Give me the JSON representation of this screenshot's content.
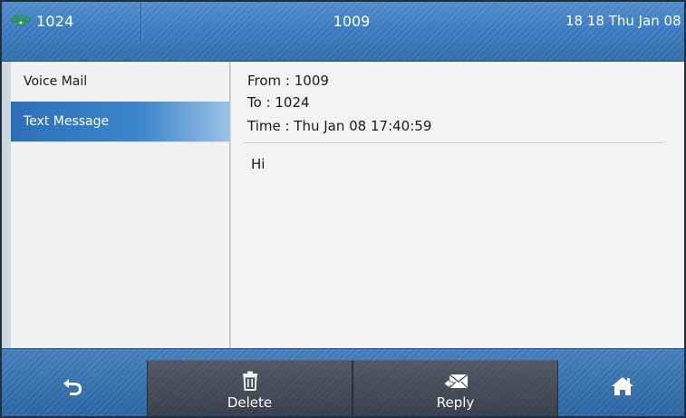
{
  "title_bar": {
    "account": "1024",
    "center": "1009",
    "datetime": "18 18 Thu Jan 08",
    "phone_icon": "phone-handset-icon"
  },
  "sidebar": {
    "items": [
      {
        "label": "Voice Mail"
      },
      {
        "label": "Text Message",
        "selected": true
      }
    ]
  },
  "message": {
    "from": "From : 1009",
    "to": "To : 1024",
    "time": "Time : Thu Jan 08 17:40:59",
    "body": "Hi"
  },
  "softkeys": {
    "back_icon": "back-arrow-icon",
    "delete_label": "Delete",
    "delete_icon": "trash-icon",
    "reply_label": "Reply",
    "reply_icon": "envelope-reply-icon",
    "home_icon": "home-icon"
  },
  "colors": {
    "accent": "#3a7cc2",
    "selected": "#2d6fb6",
    "phone_icon": "#2ea84a"
  }
}
